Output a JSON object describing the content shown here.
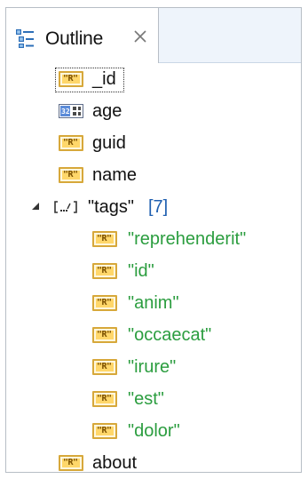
{
  "view": {
    "title": "Outline",
    "close_symbol": "×"
  },
  "tree": {
    "fields": [
      "_id",
      "age",
      "guid",
      "name"
    ],
    "tags": {
      "label": "\"tags\"",
      "count": "[7]",
      "items": [
        "\"reprehenderit\"",
        "\"id\"",
        "\"anim\"",
        "\"occaecat\"",
        "\"irure\"",
        "\"est\"",
        "\"dolor\""
      ]
    },
    "last": "about"
  },
  "icons": {
    "string": "string-field-icon",
    "number": "number-field-icon",
    "array": "array-field-icon",
    "outline": "outline-icon",
    "expanded": "expanded-triangle-icon"
  },
  "colors": {
    "string_values": "#2b9d3f",
    "count": "#1f5fb0",
    "tab_bar": "#eef4fb"
  }
}
